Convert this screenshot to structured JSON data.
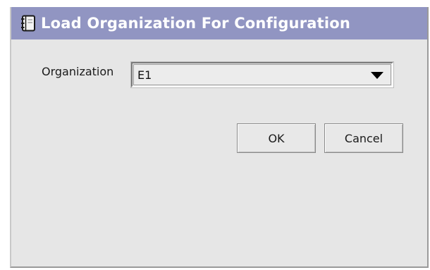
{
  "window": {
    "title": "Load Organization For Configuration",
    "title_icon": "notebook-icon"
  },
  "form": {
    "organization_label": "Organization",
    "organization_value": "E1"
  },
  "buttons": {
    "ok_label": "OK",
    "cancel_label": "Cancel"
  },
  "colors": {
    "titlebar": "#9195c2",
    "dialog_bg": "#e6e6e6"
  }
}
